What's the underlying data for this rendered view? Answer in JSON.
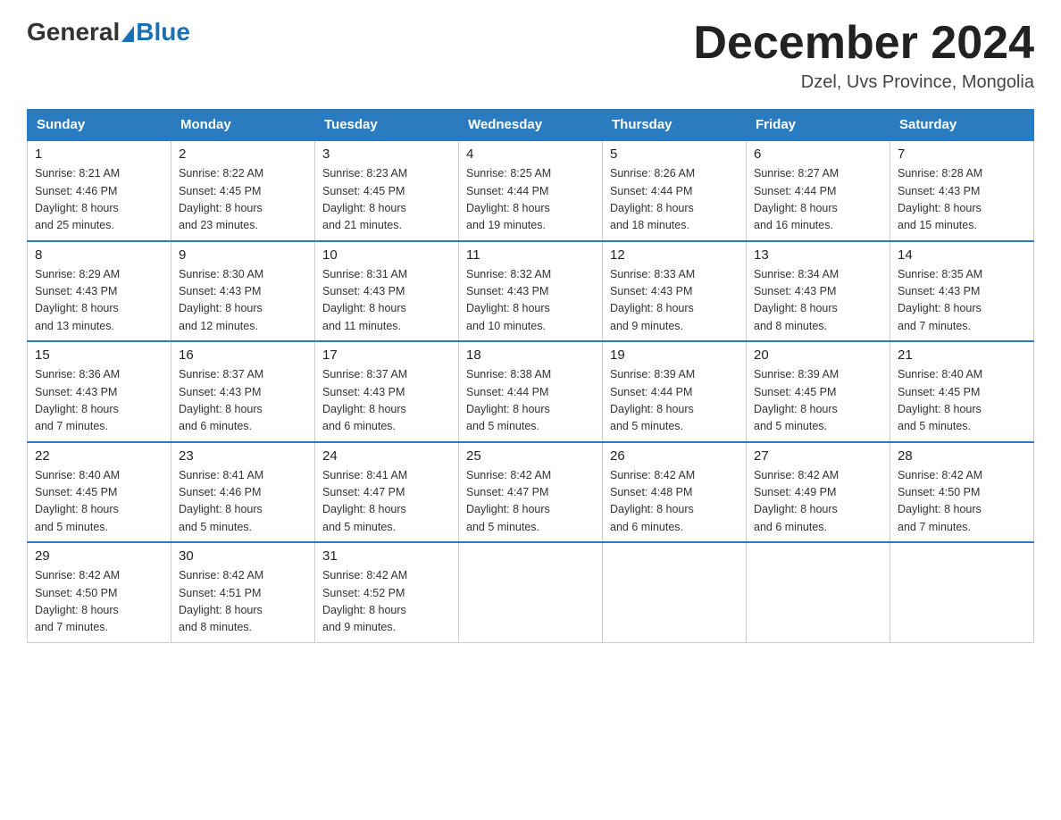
{
  "logo": {
    "general": "General",
    "blue": "Blue"
  },
  "title": "December 2024",
  "location": "Dzel, Uvs Province, Mongolia",
  "days_of_week": [
    "Sunday",
    "Monday",
    "Tuesday",
    "Wednesday",
    "Thursday",
    "Friday",
    "Saturday"
  ],
  "weeks": [
    [
      {
        "day": "1",
        "sunrise": "8:21 AM",
        "sunset": "4:46 PM",
        "daylight": "8 hours and 25 minutes."
      },
      {
        "day": "2",
        "sunrise": "8:22 AM",
        "sunset": "4:45 PM",
        "daylight": "8 hours and 23 minutes."
      },
      {
        "day": "3",
        "sunrise": "8:23 AM",
        "sunset": "4:45 PM",
        "daylight": "8 hours and 21 minutes."
      },
      {
        "day": "4",
        "sunrise": "8:25 AM",
        "sunset": "4:44 PM",
        "daylight": "8 hours and 19 minutes."
      },
      {
        "day": "5",
        "sunrise": "8:26 AM",
        "sunset": "4:44 PM",
        "daylight": "8 hours and 18 minutes."
      },
      {
        "day": "6",
        "sunrise": "8:27 AM",
        "sunset": "4:44 PM",
        "daylight": "8 hours and 16 minutes."
      },
      {
        "day": "7",
        "sunrise": "8:28 AM",
        "sunset": "4:43 PM",
        "daylight": "8 hours and 15 minutes."
      }
    ],
    [
      {
        "day": "8",
        "sunrise": "8:29 AM",
        "sunset": "4:43 PM",
        "daylight": "8 hours and 13 minutes."
      },
      {
        "day": "9",
        "sunrise": "8:30 AM",
        "sunset": "4:43 PM",
        "daylight": "8 hours and 12 minutes."
      },
      {
        "day": "10",
        "sunrise": "8:31 AM",
        "sunset": "4:43 PM",
        "daylight": "8 hours and 11 minutes."
      },
      {
        "day": "11",
        "sunrise": "8:32 AM",
        "sunset": "4:43 PM",
        "daylight": "8 hours and 10 minutes."
      },
      {
        "day": "12",
        "sunrise": "8:33 AM",
        "sunset": "4:43 PM",
        "daylight": "8 hours and 9 minutes."
      },
      {
        "day": "13",
        "sunrise": "8:34 AM",
        "sunset": "4:43 PM",
        "daylight": "8 hours and 8 minutes."
      },
      {
        "day": "14",
        "sunrise": "8:35 AM",
        "sunset": "4:43 PM",
        "daylight": "8 hours and 7 minutes."
      }
    ],
    [
      {
        "day": "15",
        "sunrise": "8:36 AM",
        "sunset": "4:43 PM",
        "daylight": "8 hours and 7 minutes."
      },
      {
        "day": "16",
        "sunrise": "8:37 AM",
        "sunset": "4:43 PM",
        "daylight": "8 hours and 6 minutes."
      },
      {
        "day": "17",
        "sunrise": "8:37 AM",
        "sunset": "4:43 PM",
        "daylight": "8 hours and 6 minutes."
      },
      {
        "day": "18",
        "sunrise": "8:38 AM",
        "sunset": "4:44 PM",
        "daylight": "8 hours and 5 minutes."
      },
      {
        "day": "19",
        "sunrise": "8:39 AM",
        "sunset": "4:44 PM",
        "daylight": "8 hours and 5 minutes."
      },
      {
        "day": "20",
        "sunrise": "8:39 AM",
        "sunset": "4:45 PM",
        "daylight": "8 hours and 5 minutes."
      },
      {
        "day": "21",
        "sunrise": "8:40 AM",
        "sunset": "4:45 PM",
        "daylight": "8 hours and 5 minutes."
      }
    ],
    [
      {
        "day": "22",
        "sunrise": "8:40 AM",
        "sunset": "4:45 PM",
        "daylight": "8 hours and 5 minutes."
      },
      {
        "day": "23",
        "sunrise": "8:41 AM",
        "sunset": "4:46 PM",
        "daylight": "8 hours and 5 minutes."
      },
      {
        "day": "24",
        "sunrise": "8:41 AM",
        "sunset": "4:47 PM",
        "daylight": "8 hours and 5 minutes."
      },
      {
        "day": "25",
        "sunrise": "8:42 AM",
        "sunset": "4:47 PM",
        "daylight": "8 hours and 5 minutes."
      },
      {
        "day": "26",
        "sunrise": "8:42 AM",
        "sunset": "4:48 PM",
        "daylight": "8 hours and 6 minutes."
      },
      {
        "day": "27",
        "sunrise": "8:42 AM",
        "sunset": "4:49 PM",
        "daylight": "8 hours and 6 minutes."
      },
      {
        "day": "28",
        "sunrise": "8:42 AM",
        "sunset": "4:50 PM",
        "daylight": "8 hours and 7 minutes."
      }
    ],
    [
      {
        "day": "29",
        "sunrise": "8:42 AM",
        "sunset": "4:50 PM",
        "daylight": "8 hours and 7 minutes."
      },
      {
        "day": "30",
        "sunrise": "8:42 AM",
        "sunset": "4:51 PM",
        "daylight": "8 hours and 8 minutes."
      },
      {
        "day": "31",
        "sunrise": "8:42 AM",
        "sunset": "4:52 PM",
        "daylight": "8 hours and 9 minutes."
      },
      null,
      null,
      null,
      null
    ]
  ],
  "labels": {
    "sunrise": "Sunrise:",
    "sunset": "Sunset:",
    "daylight": "Daylight:"
  }
}
